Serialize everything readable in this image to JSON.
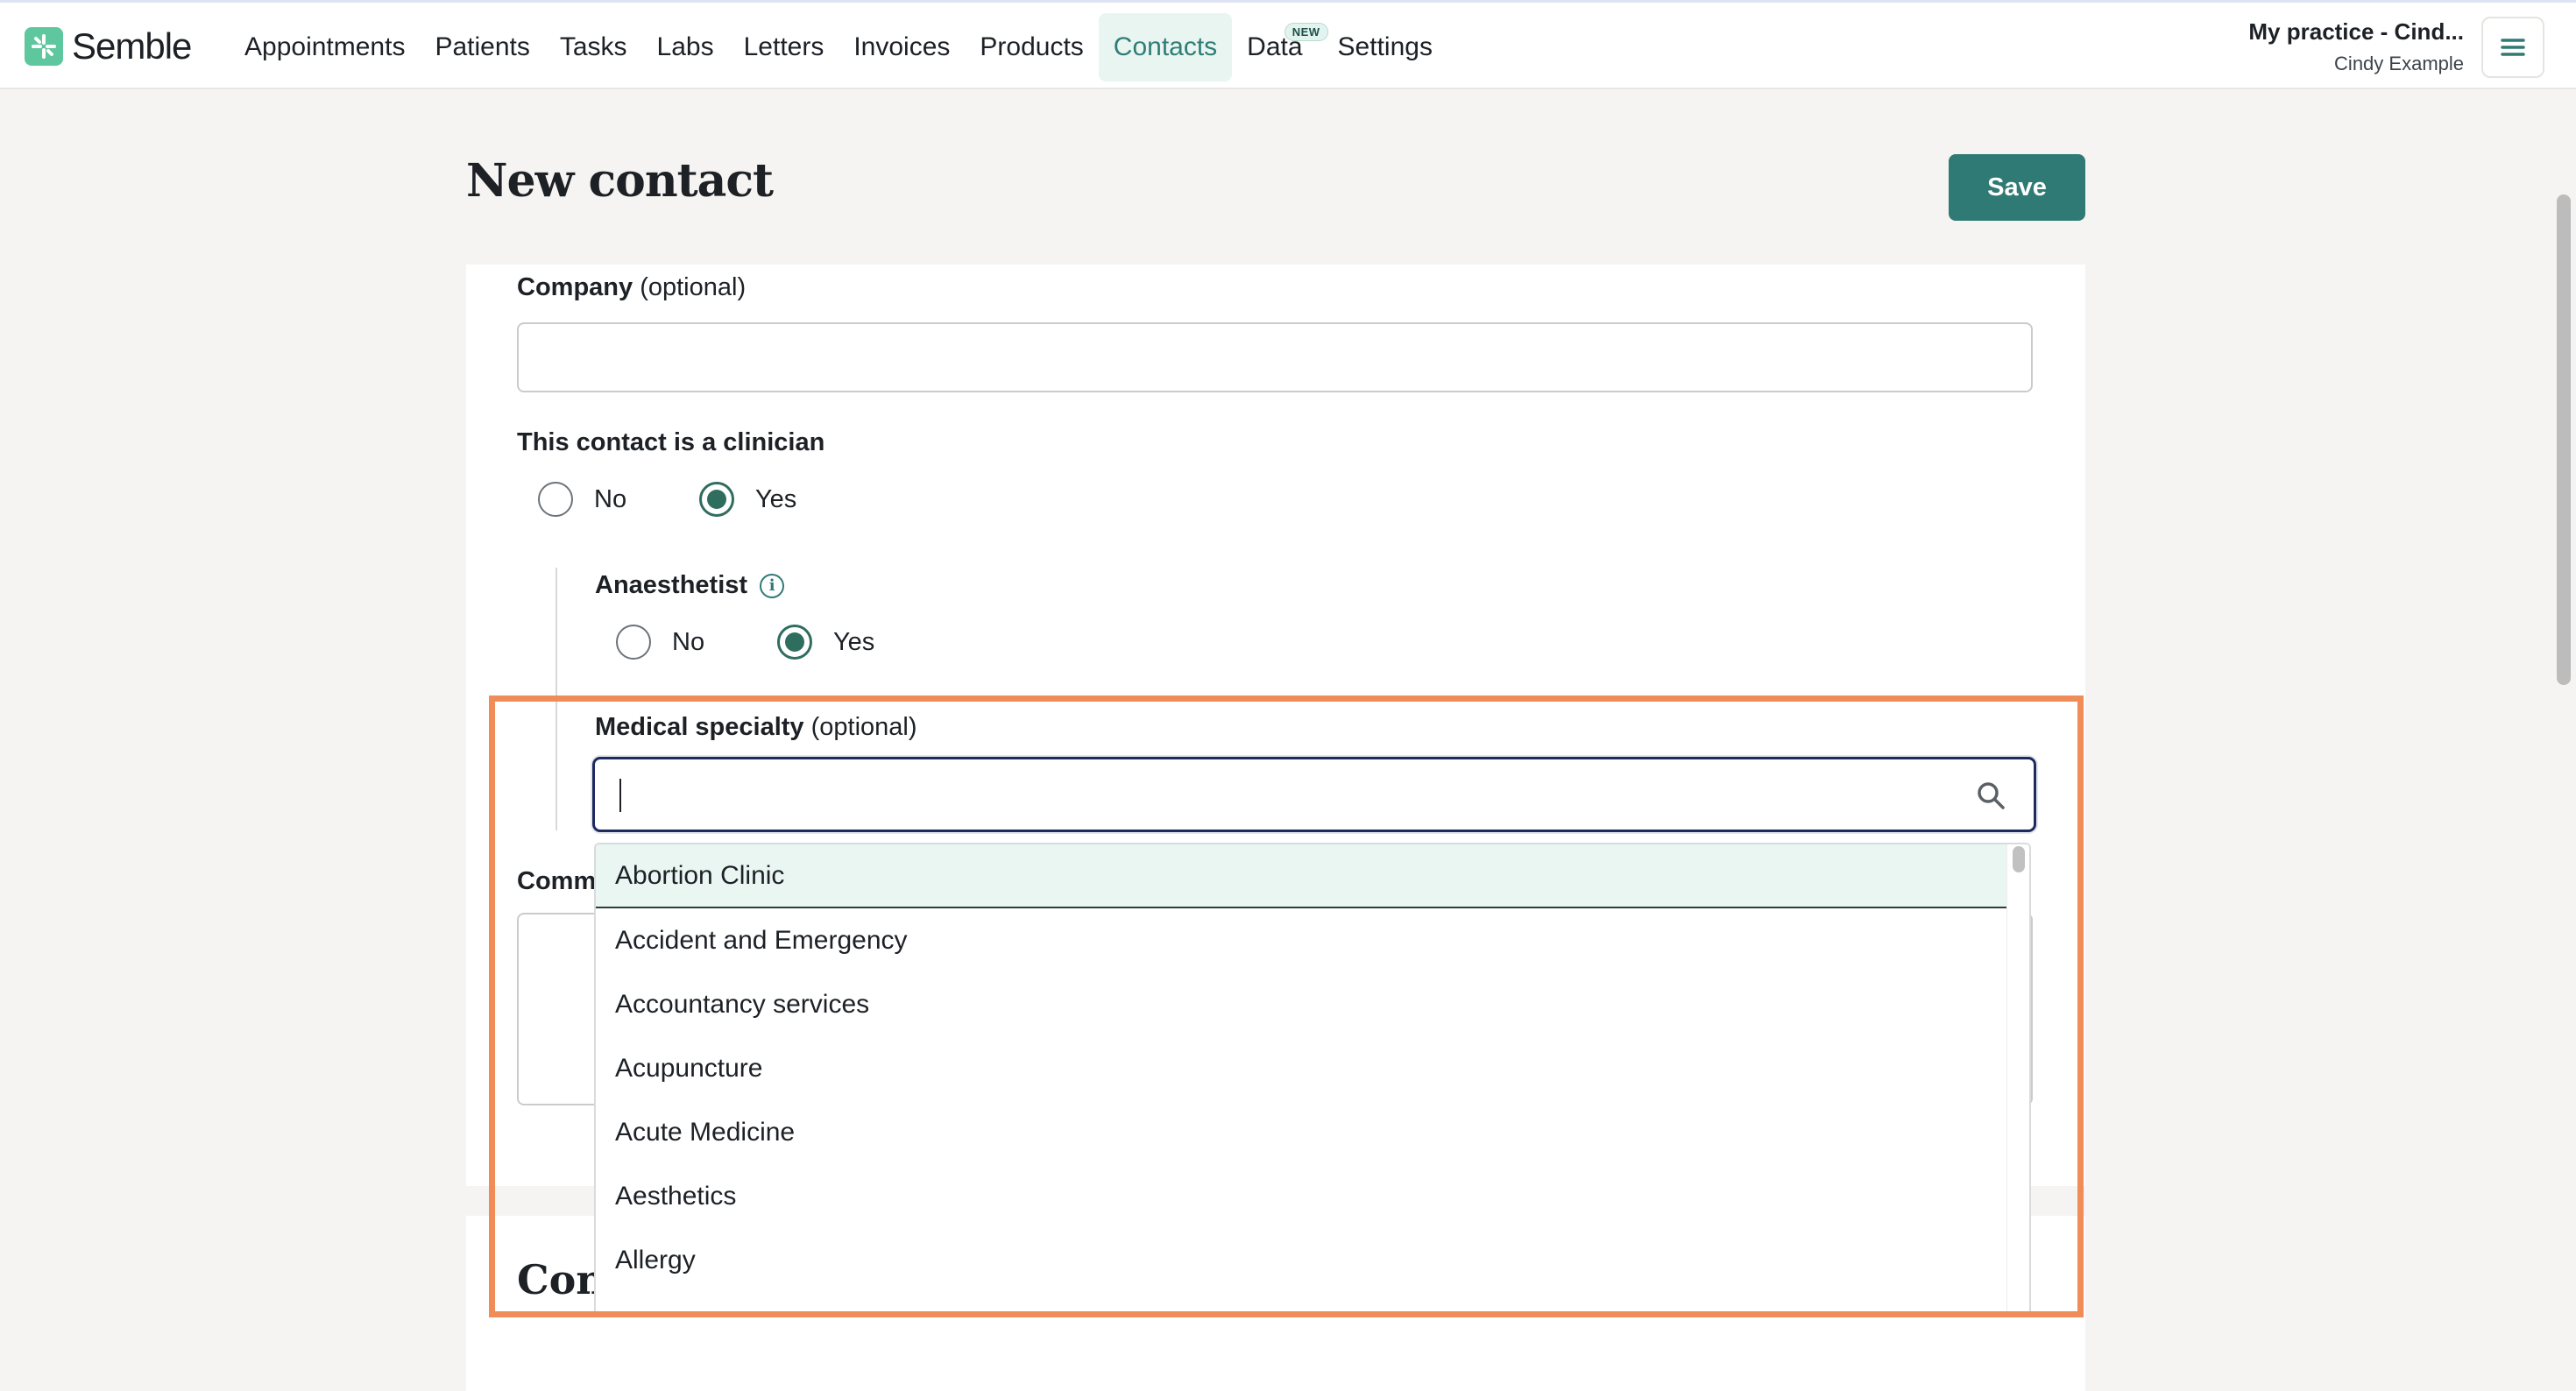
{
  "app": {
    "logo_text": "Semble"
  },
  "nav": {
    "items": [
      {
        "label": "Appointments"
      },
      {
        "label": "Patients"
      },
      {
        "label": "Tasks"
      },
      {
        "label": "Labs"
      },
      {
        "label": "Letters"
      },
      {
        "label": "Invoices"
      },
      {
        "label": "Products"
      },
      {
        "label": "Contacts",
        "active": true
      },
      {
        "label": "Data",
        "badge": "NEW"
      },
      {
        "label": "Settings"
      }
    ]
  },
  "account": {
    "practice": "My practice - Cind...",
    "user": "Cindy Example"
  },
  "page": {
    "title": "New contact",
    "save_label": "Save"
  },
  "form": {
    "company_label": "Company",
    "optional_text": "(optional)",
    "company_value": "",
    "clinician_label": "This contact is a clinician",
    "clinician_no": "No",
    "clinician_yes": "Yes",
    "clinician_selected": "Yes",
    "anaesthetist_label": "Anaesthetist",
    "anaesthetist_no": "No",
    "anaesthetist_yes": "Yes",
    "anaesthetist_selected": "Yes",
    "specialty_label": "Medical specialty",
    "specialty_value": "",
    "comments_label_visible": "Comm",
    "section2_title_visible": "Con"
  },
  "specialty_options": [
    "Abortion Clinic",
    "Accident and Emergency",
    "Accountancy services",
    "Acupuncture",
    "Acute Medicine",
    "Aesthetics",
    "Allergy"
  ],
  "colors": {
    "accent": "#2f7a74",
    "highlight_outline": "#ef8c57",
    "logo": "#5ec79d"
  }
}
